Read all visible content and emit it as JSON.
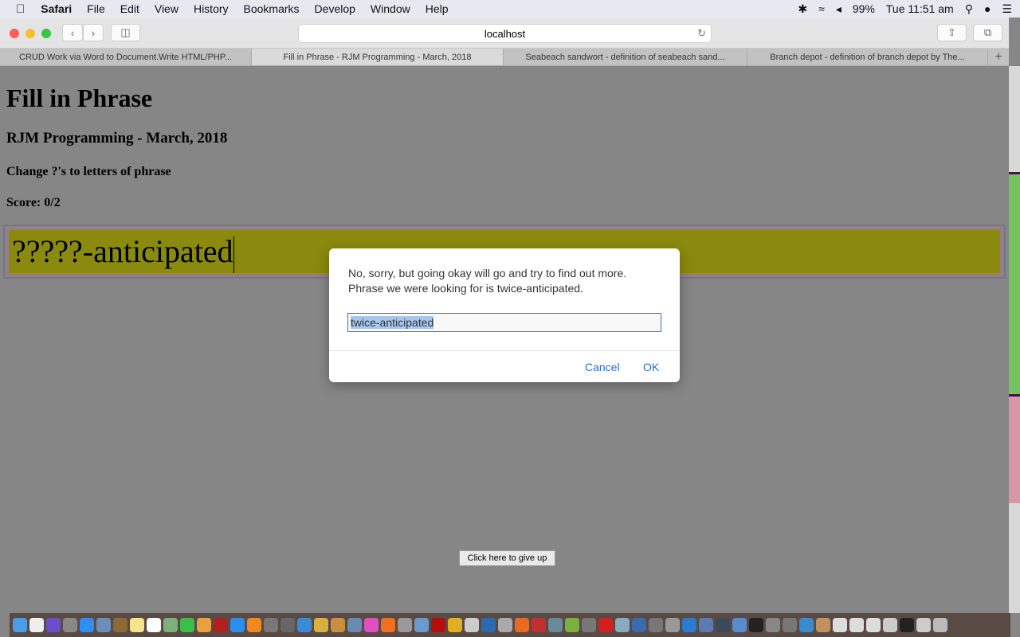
{
  "menubar": {
    "app": "Safari",
    "items": [
      "File",
      "Edit",
      "View",
      "History",
      "Bookmarks",
      "Develop",
      "Window",
      "Help"
    ],
    "battery": "99%",
    "clock": "Tue 11:51 am"
  },
  "toolbar": {
    "url": "localhost"
  },
  "tabs": [
    "CRUD Work via Word to Document.Write HTML/PHP...",
    "Fill in Phrase - RJM Programming - March, 2018",
    "Seabeach sandwort - definition of seabeach sand...",
    "Branch depot - definition of branch depot by The..."
  ],
  "active_tab": 1,
  "page": {
    "title": "Fill in Phrase",
    "subtitle": "RJM Programming - March, 2018",
    "instruction": "Change ?'s to letters of phrase",
    "score": "Score: 0/2",
    "phrase": "?????-anticipated",
    "give_up": "Click here to give up"
  },
  "colors": {
    "phrase_bg": "#8a8a0e",
    "strip_green": "#73c460",
    "strip_pink": "#d797a6",
    "link": "#2d6cc8"
  },
  "dialog": {
    "message_line1": "No, sorry, but going okay will go and try to find out more.",
    "message_line2": "Phrase we were looking for is twice-anticipated.",
    "input_value": "twice-anticipated",
    "cancel": "Cancel",
    "ok": "OK"
  },
  "dock": {
    "icons": [
      [
        "finder-icon",
        "#4a9ee8"
      ],
      [
        "document-icon",
        "#eeeeee"
      ],
      [
        "siri-icon",
        "#6a4fc8"
      ],
      [
        "launchpad-icon",
        "#888"
      ],
      [
        "safari-icon",
        "#2f8ff0"
      ],
      [
        "preview-icon",
        "#6b8fb8"
      ],
      [
        "notebook-icon",
        "#8b6a3a"
      ],
      [
        "notes-icon",
        "#f4e48a"
      ],
      [
        "calendar-icon",
        "#fff"
      ],
      [
        "maps-icon",
        "#7fb07a"
      ],
      [
        "facetime-icon",
        "#3bbf4a"
      ],
      [
        "photos-icon",
        "#e8a040"
      ],
      [
        "photo-booth-icon",
        "#b02020"
      ],
      [
        "app-store-icon",
        "#2a8ef0"
      ],
      [
        "ibooks-icon",
        "#f08a20"
      ],
      [
        "system-preferences-icon",
        "#777"
      ],
      [
        "gimp-icon",
        "#666"
      ],
      [
        "xcode-icon",
        "#3a8ad8"
      ],
      [
        "app-icon",
        "#d8b040"
      ],
      [
        "app-icon",
        "#c89040"
      ],
      [
        "app-icon",
        "#6a8ab0"
      ],
      [
        "itunes-icon",
        "#e050c0"
      ],
      [
        "avast-icon",
        "#f07020"
      ],
      [
        "app-icon",
        "#999"
      ],
      [
        "app-icon",
        "#6a9ad0"
      ],
      [
        "filezilla-icon",
        "#b01010"
      ],
      [
        "chrome-icon",
        "#e0b020"
      ],
      [
        "app-icon",
        "#ccc"
      ],
      [
        "app-icon",
        "#2a6ab0"
      ],
      [
        "app-icon",
        "#aaa"
      ],
      [
        "firefox-icon",
        "#e86a20"
      ],
      [
        "app-icon",
        "#c03030"
      ],
      [
        "app-icon",
        "#6a8a9a"
      ],
      [
        "android-icon",
        "#7ab040"
      ],
      [
        "help-icon",
        "#777"
      ],
      [
        "opera-icon",
        "#d02020"
      ],
      [
        "app-icon",
        "#8aaac0"
      ],
      [
        "virtualbox-icon",
        "#3a6ab0"
      ],
      [
        "help-icon",
        "#777"
      ],
      [
        "app-icon",
        "#999"
      ],
      [
        "vscode-icon",
        "#2a7ad0"
      ],
      [
        "app-icon",
        "#5a7ab0"
      ],
      [
        "app-icon",
        "#3a4a5a"
      ],
      [
        "app-icon",
        "#5a8ad0"
      ],
      [
        "github-icon",
        "#222"
      ],
      [
        "app-icon",
        "#888"
      ],
      [
        "help-icon",
        "#777"
      ],
      [
        "app-icon",
        "#3a8ad0"
      ],
      [
        "app-icon",
        "#c09060"
      ],
      [
        "app-icon",
        "#ddd"
      ],
      [
        "app-icon",
        "#ddd"
      ],
      [
        "app-icon",
        "#ddd"
      ],
      [
        "app-icon",
        "#ccc"
      ],
      [
        "app-icon",
        "#222"
      ],
      [
        "app-icon",
        "#ccc"
      ],
      [
        "trash-icon",
        "#bbb"
      ]
    ]
  }
}
